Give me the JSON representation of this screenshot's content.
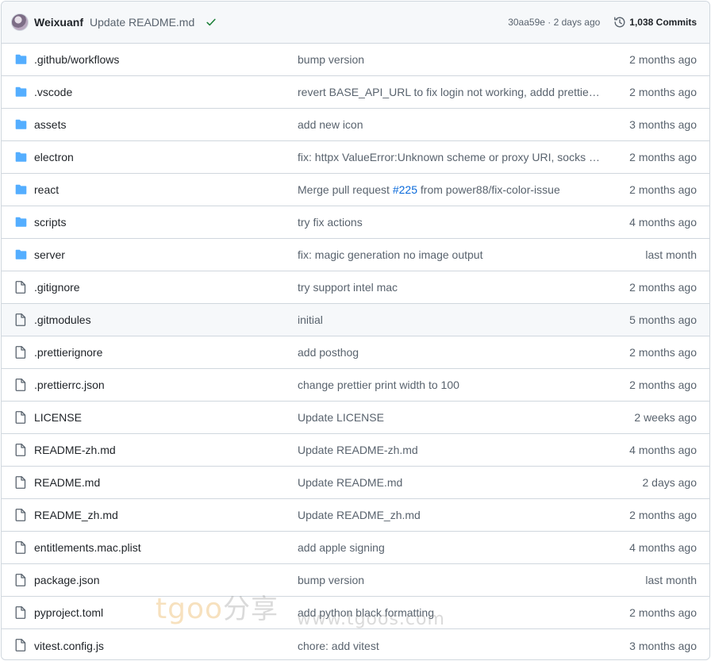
{
  "header": {
    "author": "Weixuanf",
    "commit_message": "Update README.md",
    "sha_date": "30aa59e · 2 days ago",
    "commits_label": "1,038 Commits"
  },
  "colors": {
    "folder": "#54aeff",
    "check": "#1a7f37",
    "link": "#0969da",
    "muted": "#59636e"
  },
  "files": [
    {
      "name": ".github/workflows",
      "type": "folder",
      "message": "bump version",
      "age": "2 months ago"
    },
    {
      "name": ".vscode",
      "type": "folder",
      "message": "revert BASE_API_URL to fix login not working, addd prettier ...",
      "age": "2 months ago"
    },
    {
      "name": "assets",
      "type": "folder",
      "message": "add new icon",
      "age": "3 months ago"
    },
    {
      "name": "electron",
      "type": "folder",
      "message": "fix: httpx ValueError:Unknown scheme or proxy URI, socks to...",
      "age": "2 months ago"
    },
    {
      "name": "react",
      "type": "folder",
      "message_pre": "Merge pull request ",
      "message_link": "#225",
      "message_post": " from power88/fix-color-issue",
      "age": "2 months ago"
    },
    {
      "name": "scripts",
      "type": "folder",
      "message": "try fix actions",
      "age": "4 months ago"
    },
    {
      "name": "server",
      "type": "folder",
      "message": "fix: magic generation no image output",
      "age": "last month"
    },
    {
      "name": ".gitignore",
      "type": "file",
      "message": "try support intel mac",
      "age": "2 months ago"
    },
    {
      "name": ".gitmodules",
      "type": "file",
      "message": "initial",
      "age": "5 months ago"
    },
    {
      "name": ".prettierignore",
      "type": "file",
      "message": "add posthog",
      "age": "2 months ago"
    },
    {
      "name": ".prettierrc.json",
      "type": "file",
      "message": "change prettier print width to 100",
      "age": "2 months ago"
    },
    {
      "name": "LICENSE",
      "type": "file",
      "message": "Update LICENSE",
      "age": "2 weeks ago"
    },
    {
      "name": "README-zh.md",
      "type": "file",
      "message": "Update README-zh.md",
      "age": "4 months ago"
    },
    {
      "name": "README.md",
      "type": "file",
      "message": "Update README.md",
      "age": "2 days ago"
    },
    {
      "name": "README_zh.md",
      "type": "file",
      "message": "Update README_zh.md",
      "age": "2 months ago"
    },
    {
      "name": "entitlements.mac.plist",
      "type": "file",
      "message": "add apple signing",
      "age": "4 months ago"
    },
    {
      "name": "package.json",
      "type": "file",
      "message": "bump version",
      "age": "last month"
    },
    {
      "name": "pyproject.toml",
      "type": "file",
      "message": "add python black formatting",
      "age": "2 months ago"
    },
    {
      "name": "vitest.config.js",
      "type": "file",
      "message": "chore: add vitest",
      "age": "3 months ago"
    }
  ],
  "watermark": {
    "text": "tgoo",
    "han": "分享",
    "url": "www.tgoos.com"
  }
}
